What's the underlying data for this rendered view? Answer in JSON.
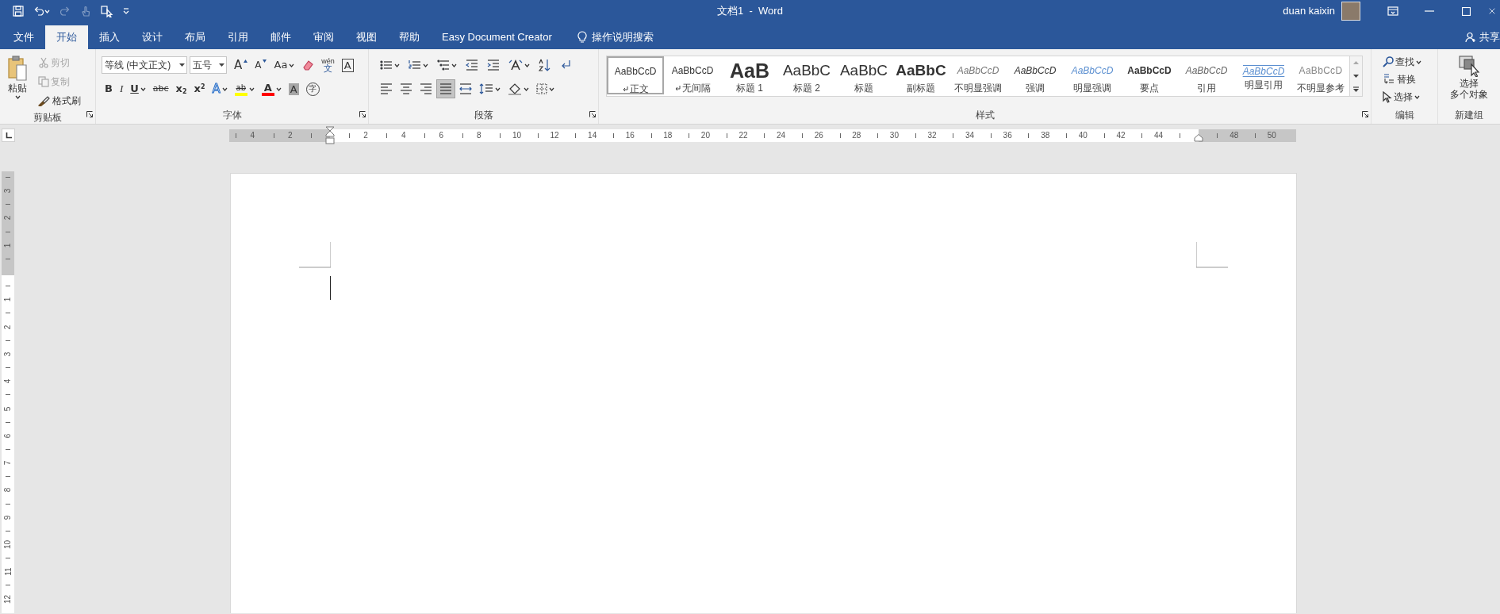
{
  "title_bar": {
    "title": "文档1  -  Word",
    "user": "duan kaixin",
    "quick_access": [
      {
        "kind": "save",
        "disabled": false
      },
      {
        "kind": "undo",
        "disabled": false
      },
      {
        "kind": "redo",
        "disabled": true
      },
      {
        "kind": "touch",
        "disabled": true
      },
      {
        "kind": "pointer",
        "disabled": false
      },
      {
        "kind": "customize",
        "disabled": false
      }
    ]
  },
  "tabs": [
    {
      "label": "文件",
      "selected": false
    },
    {
      "label": "开始",
      "selected": true
    },
    {
      "label": "插入",
      "selected": false
    },
    {
      "label": "设计",
      "selected": false
    },
    {
      "label": "布局",
      "selected": false
    },
    {
      "label": "引用",
      "selected": false
    },
    {
      "label": "邮件",
      "selected": false
    },
    {
      "label": "审阅",
      "selected": false
    },
    {
      "label": "视图",
      "selected": false
    },
    {
      "label": "帮助",
      "selected": false
    },
    {
      "label": "Easy Document Creator",
      "selected": false
    }
  ],
  "tell_me": "操作说明搜索",
  "share": "共享",
  "clipboard": {
    "group_label": "剪贴板",
    "paste": "粘贴",
    "actions": [
      {
        "kind": "cut",
        "label": "剪切",
        "disabled": true
      },
      {
        "kind": "copy",
        "label": "复制",
        "disabled": true
      },
      {
        "kind": "format-painter",
        "label": "格式刷",
        "disabled": false
      }
    ]
  },
  "font": {
    "group_label": "字体",
    "font_name": "等线 (中文正文)",
    "font_size": "五号",
    "row1": [
      {
        "kind": "grow",
        "label": "A",
        "dropdown": false
      },
      {
        "kind": "shrink",
        "label": "A",
        "dropdown": false
      },
      {
        "kind": "case",
        "label": "Aa",
        "dropdown": true
      },
      {
        "kind": "clear",
        "dropdown": false
      },
      {
        "kind": "phonetic",
        "label": "wén",
        "sublabel": "文",
        "dropdown": false
      },
      {
        "kind": "border",
        "label": "A",
        "dropdown": false
      }
    ],
    "row2": [
      {
        "kind": "bold",
        "label": "B",
        "dropdown": false
      },
      {
        "kind": "italic",
        "label": "I",
        "dropdown": false
      },
      {
        "kind": "underline",
        "label": "U",
        "dropdown": true
      },
      {
        "kind": "strike",
        "label": "abc",
        "dropdown": false
      },
      {
        "kind": "subscript",
        "label": "x",
        "sublabel": "2",
        "dropdown": false
      },
      {
        "kind": "superscript",
        "label": "x",
        "sublabel": "2",
        "dropdown": false
      },
      {
        "kind": "effects",
        "label": "A",
        "dropdown": true
      },
      {
        "kind": "highlight",
        "label": "ab",
        "color": "#ffff00",
        "dropdown": true
      },
      {
        "kind": "font-color",
        "label": "A",
        "color": "#ff0000",
        "dropdown": true
      },
      {
        "kind": "shading",
        "label": "A",
        "dropdown": false
      },
      {
        "kind": "enclose",
        "label": "字",
        "dropdown": false
      }
    ]
  },
  "paragraph": {
    "group_label": "段落",
    "row1": [
      {
        "kind": "bullets",
        "dropdown": true
      },
      {
        "kind": "numbering",
        "dropdown": true
      },
      {
        "kind": "multilevel",
        "dropdown": true
      },
      {
        "kind": "decrease-indent",
        "dropdown": false
      },
      {
        "kind": "increase-indent",
        "dropdown": false
      },
      {
        "kind": "asian-layout",
        "dropdown": true
      },
      {
        "kind": "sort",
        "dropdown": false
      },
      {
        "kind": "show-marks",
        "dropdown": false
      }
    ],
    "row2": [
      {
        "kind": "align-left",
        "dropdown": false,
        "selected": false
      },
      {
        "kind": "align-center",
        "dropdown": false,
        "selected": false
      },
      {
        "kind": "align-right",
        "dropdown": false,
        "selected": false
      },
      {
        "kind": "justify",
        "dropdown": false,
        "selected": true
      },
      {
        "kind": "distributed",
        "dropdown": false,
        "selected": false
      },
      {
        "kind": "line-spacing",
        "dropdown": true,
        "selected": false
      },
      {
        "kind": "shading",
        "dropdown": true,
        "selected": false
      },
      {
        "kind": "borders",
        "dropdown": true,
        "selected": false
      }
    ]
  },
  "styles": {
    "group_label": "样式",
    "items": [
      {
        "preview": "AaBbCcD",
        "name": "正文",
        "kind": "normal",
        "paragraph_mark": true,
        "selected": true
      },
      {
        "preview": "AaBbCcD",
        "name": "无间隔",
        "kind": "normal",
        "paragraph_mark": true,
        "selected": false
      },
      {
        "preview": "AaB",
        "name": "标题 1",
        "kind": "heading1",
        "paragraph_mark": false,
        "selected": false
      },
      {
        "preview": "AaBbC",
        "name": "标题 2",
        "kind": "heading2",
        "paragraph_mark": false,
        "selected": false
      },
      {
        "preview": "AaBbC",
        "name": "标题",
        "kind": "title",
        "paragraph_mark": false,
        "selected": false
      },
      {
        "preview": "AaBbC",
        "name": "副标题",
        "kind": "subtitle",
        "paragraph_mark": false,
        "selected": false
      },
      {
        "preview": "AaBbCcD",
        "name": "不明显强调",
        "kind": "subtle-emphasis",
        "paragraph_mark": false,
        "selected": false
      },
      {
        "preview": "AaBbCcD",
        "name": "强调",
        "kind": "emphasis",
        "paragraph_mark": false,
        "selected": false
      },
      {
        "preview": "AaBbCcD",
        "name": "明显强调",
        "kind": "intense-emphasis",
        "paragraph_mark": false,
        "selected": false
      },
      {
        "preview": "AaBbCcD",
        "name": "要点",
        "kind": "strong",
        "paragraph_mark": false,
        "selected": false
      },
      {
        "preview": "AaBbCcD",
        "name": "引用",
        "kind": "quote",
        "paragraph_mark": false,
        "selected": false
      },
      {
        "preview": "AaBbCcD",
        "name": "明显引用",
        "kind": "intense-quote",
        "paragraph_mark": false,
        "selected": false
      },
      {
        "preview": "AaBbCcD",
        "name": "不明显参考",
        "kind": "subtle-reference",
        "paragraph_mark": false,
        "selected": false
      }
    ]
  },
  "editing": {
    "group_label": "编辑",
    "items": [
      {
        "kind": "find",
        "label": "查找",
        "dropdown": true
      },
      {
        "kind": "replace",
        "label": "替换",
        "dropdown": false
      },
      {
        "kind": "select",
        "label": "选择",
        "dropdown": true
      }
    ]
  },
  "new_group": {
    "group_label": "新建组",
    "button_lines": [
      "选择",
      "多个对象"
    ]
  },
  "ruler": {
    "marks": [
      {
        "kind": "number",
        "label": "4"
      },
      {
        "kind": "number",
        "label": "2"
      },
      {
        "kind": "indent-left"
      },
      {
        "kind": "number",
        "label": "2"
      },
      {
        "kind": "number",
        "label": "4"
      },
      {
        "kind": "number",
        "label": "6"
      },
      {
        "kind": "number",
        "label": "8"
      },
      {
        "kind": "number",
        "label": "10"
      },
      {
        "kind": "number",
        "label": "12"
      },
      {
        "kind": "number",
        "label": "14"
      },
      {
        "kind": "number",
        "label": "16"
      },
      {
        "kind": "number",
        "label": "18"
      },
      {
        "kind": "number",
        "label": "20"
      },
      {
        "kind": "number",
        "label": "22"
      },
      {
        "kind": "number",
        "label": "24"
      },
      {
        "kind": "number",
        "label": "26"
      },
      {
        "kind": "number",
        "label": "28"
      },
      {
        "kind": "number",
        "label": "30"
      },
      {
        "kind": "number",
        "label": "32"
      },
      {
        "kind": "number",
        "label": "34"
      },
      {
        "kind": "number",
        "label": "36"
      },
      {
        "kind": "number",
        "label": "38"
      },
      {
        "kind": "number",
        "label": "40"
      },
      {
        "kind": "number",
        "label": "42"
      },
      {
        "kind": "number",
        "label": "44"
      },
      {
        "kind": "indent-right"
      },
      {
        "kind": "number",
        "label": "48"
      },
      {
        "kind": "number",
        "label": "50"
      }
    ]
  },
  "vertical_ruler": {
    "marks": [
      {
        "kind": "number",
        "label": "3"
      },
      {
        "kind": "number",
        "label": "2"
      },
      {
        "kind": "number",
        "label": "1"
      },
      {
        "kind": "boundary"
      },
      {
        "kind": "number",
        "label": "1"
      },
      {
        "kind": "number",
        "label": "2"
      },
      {
        "kind": "number",
        "label": "3"
      },
      {
        "kind": "number",
        "label": "4"
      },
      {
        "kind": "number",
        "label": "5"
      },
      {
        "kind": "number",
        "label": "6"
      },
      {
        "kind": "number",
        "label": "7"
      },
      {
        "kind": "number",
        "label": "8"
      },
      {
        "kind": "number",
        "label": "9"
      },
      {
        "kind": "number",
        "label": "10"
      },
      {
        "kind": "number",
        "label": "11"
      },
      {
        "kind": "number",
        "label": "12"
      }
    ]
  }
}
